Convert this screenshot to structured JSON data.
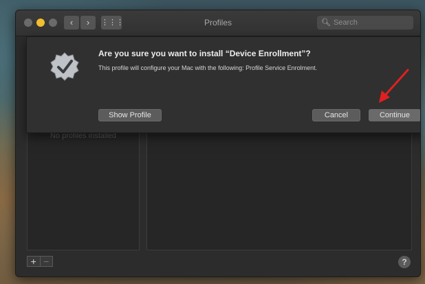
{
  "window": {
    "title": "Profiles",
    "search_placeholder": "Search",
    "nav_back_glyph": "‹",
    "nav_forward_glyph": "›",
    "grid_glyph": "⋮⋮⋮"
  },
  "dialog": {
    "title": "Are you sure you want to install “Device Enrollment”?",
    "message": "This profile will configure your Mac with the following: Profile Service Enrolment.",
    "buttons": {
      "show_profile": "Show Profile",
      "cancel": "Cancel",
      "continue": "Continue"
    },
    "icon": "verified-badge-icon"
  },
  "sidebar": {
    "empty_message": "No profiles installed"
  },
  "footer": {
    "add_glyph": "+",
    "remove_glyph": "−",
    "help_glyph": "?"
  },
  "colors": {
    "annotation_arrow": "#e02020",
    "accent_close": "#6b6b6b",
    "accent_minimize": "#f2be2f"
  }
}
